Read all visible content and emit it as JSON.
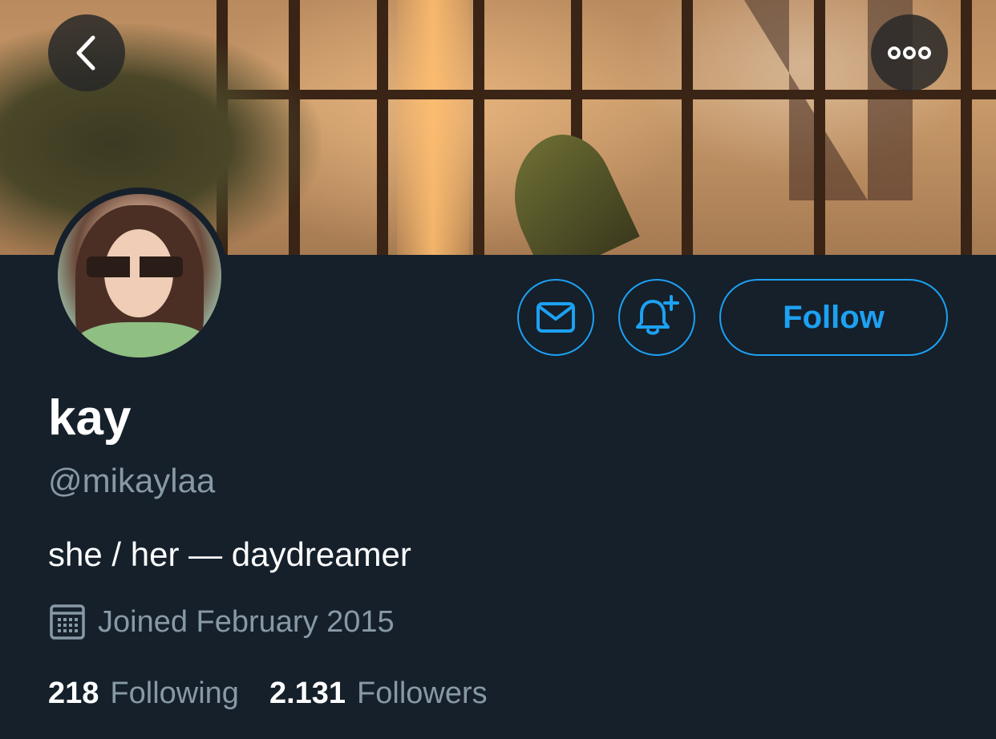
{
  "header": {
    "back_icon": "chevron-left-icon",
    "more_icon": "more-dots-icon"
  },
  "profile": {
    "display_name": "kay",
    "handle": "@mikaylaa",
    "bio": "she / her — daydreamer",
    "joined": "Joined February 2015",
    "following_count": "218",
    "following_label": "Following",
    "followers_count": "2.131",
    "followers_label": "Followers"
  },
  "actions": {
    "message_icon": "envelope-icon",
    "notify_icon": "bell-plus-icon",
    "follow_label": "Follow"
  },
  "colors": {
    "background": "#15202b",
    "accent": "#1da1f2",
    "secondary_text": "#8899a6",
    "primary_text": "#ffffff"
  }
}
